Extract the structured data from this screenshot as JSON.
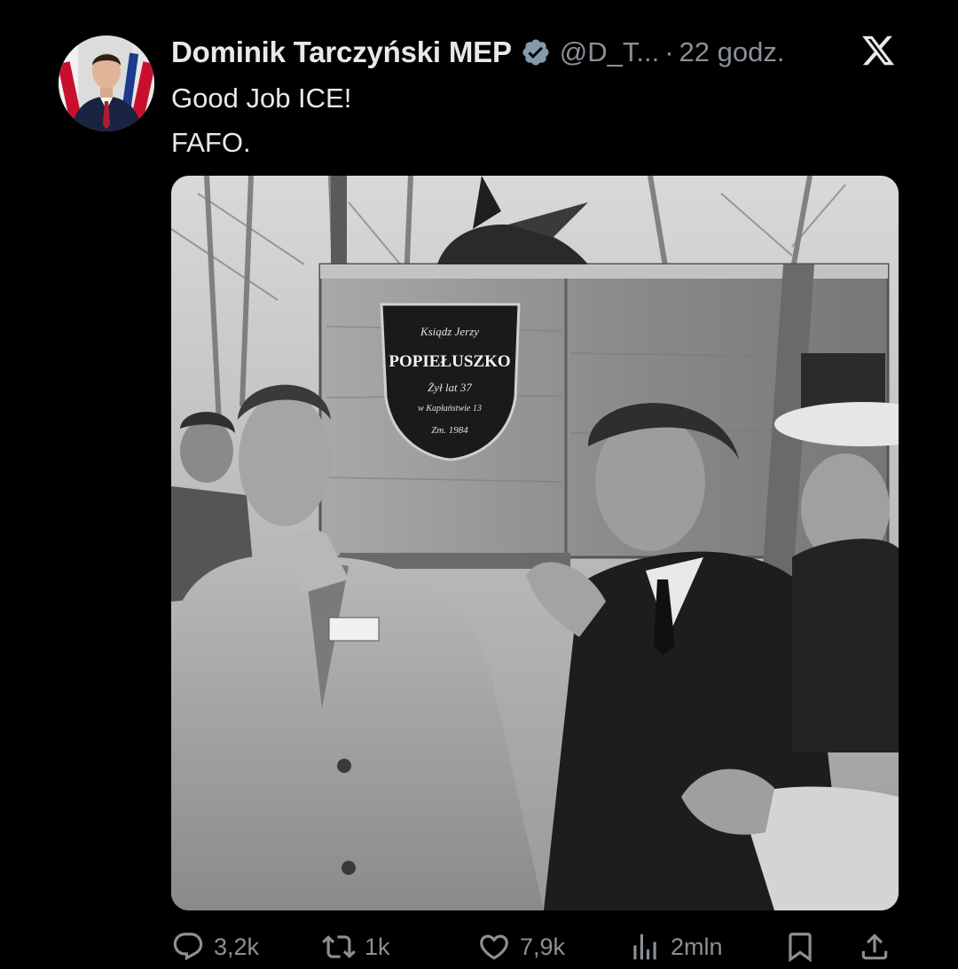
{
  "tweet": {
    "display_name": "Dominik Tarczyński MEP",
    "handle": "@D_T...",
    "separator": "·",
    "time": "22 godz.",
    "lines": [
      "Good Job ICE!",
      "FAFO."
    ],
    "verified_color": "#829aab"
  },
  "media": {
    "plaque_lines": [
      "Ksiądz Jerzy",
      "POPIEŁUSZKO",
      "Żył lat 37",
      "w Kapłaństwie 13",
      "Zm. 1984"
    ],
    "badge_text": "—"
  },
  "actions": {
    "replies": "3,2k",
    "reposts": "1k",
    "likes": "7,9k",
    "views": "2mln"
  },
  "icons": {
    "reply": "reply-icon",
    "repost": "repost-icon",
    "like": "heart-icon",
    "views": "views-icon",
    "bookmark": "bookmark-icon",
    "share": "share-icon",
    "x_logo": "x-logo-icon",
    "verified": "verified-badge-icon"
  }
}
